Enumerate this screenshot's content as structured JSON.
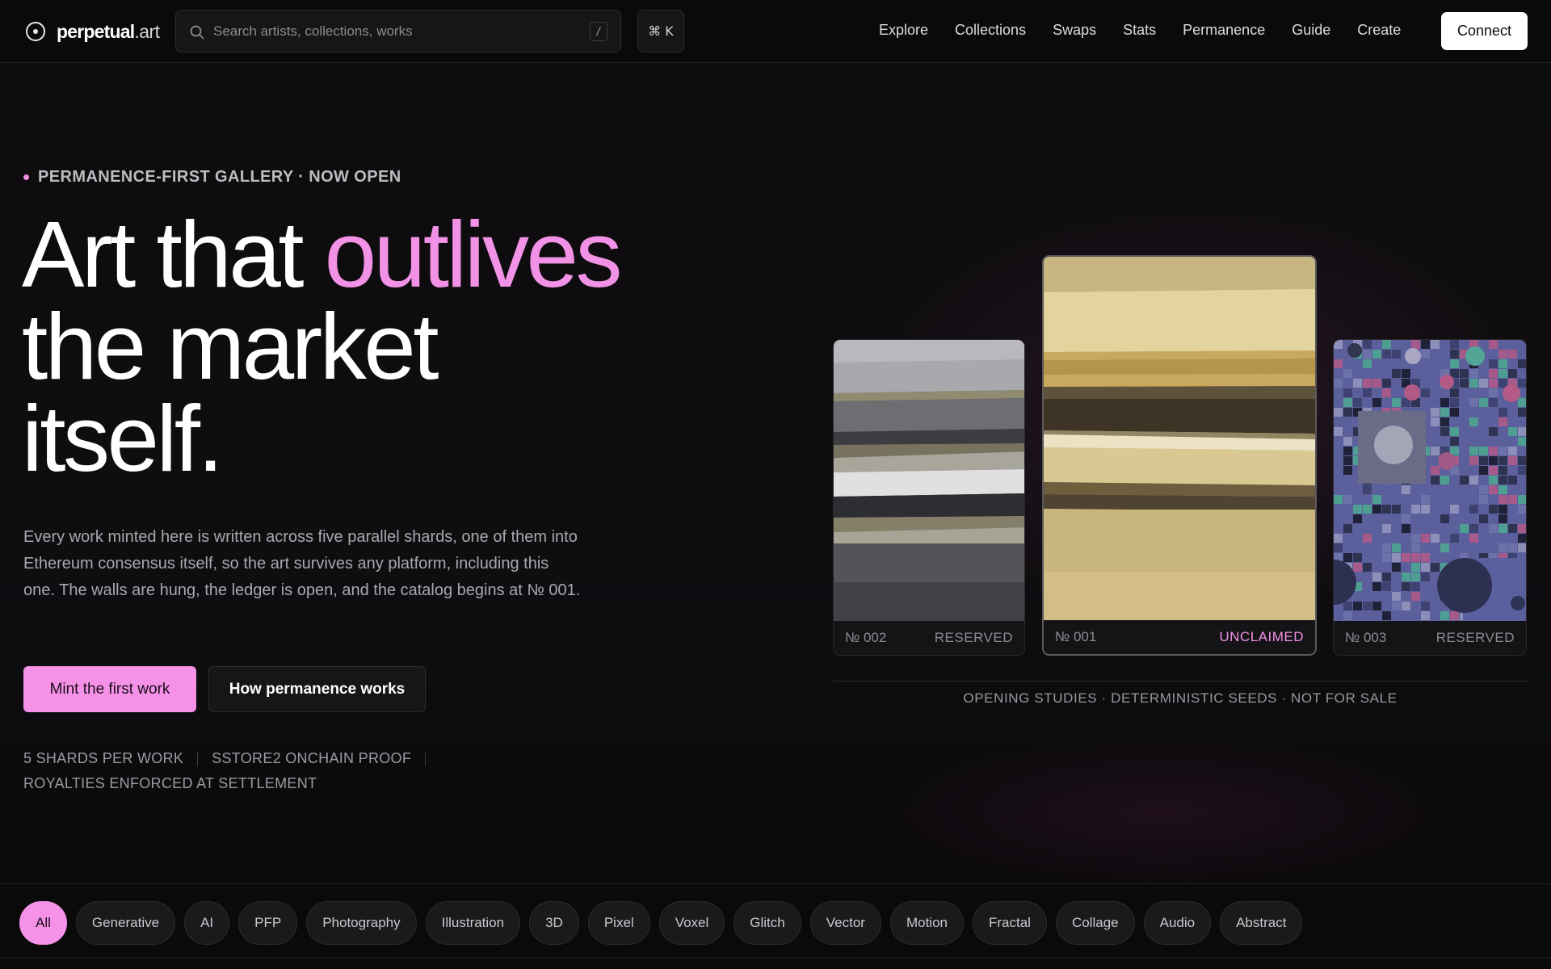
{
  "brand": {
    "name": "perpetual",
    "tld": ".art"
  },
  "search": {
    "placeholder": "Search artists, collections, works",
    "shortcut": "/"
  },
  "command_key": "⌘ K",
  "nav": {
    "links": [
      "Explore",
      "Collections",
      "Swaps",
      "Stats",
      "Permanence",
      "Guide",
      "Create"
    ],
    "connect_label": "Connect"
  },
  "hero": {
    "eyebrow": "PERMANENCE-FIRST GALLERY · NOW OPEN",
    "headline_part1": "Art that ",
    "headline_accent": "outlives",
    "headline_line2": "the market",
    "headline_line3": "itself.",
    "lede": "Every work minted here is written across five parallel shards, one of them into Ethereum consensus itself, so the art survives any platform, including this one. The walls are hung, the ledger is open, and the catalog begins at № 001.",
    "primary_cta": "Mint the first work",
    "secondary_cta": "How permanence works",
    "facts": [
      "5 SHARDS PER WORK",
      "SSTORE2 ONCHAIN PROOF",
      "ROYALTIES ENFORCED AT SETTLEMENT"
    ]
  },
  "gallery": {
    "cards": [
      {
        "number": "№ 002",
        "status": "RESERVED"
      },
      {
        "number": "№ 001",
        "status": "UNCLAIMED"
      },
      {
        "number": "№ 003",
        "status": "RESERVED"
      }
    ],
    "caption": "OPENING STUDIES · DETERMINISTIC SEEDS · NOT FOR SALE"
  },
  "categories": {
    "active": "All",
    "items": [
      "All",
      "Generative",
      "AI",
      "PFP",
      "Photography",
      "Illustration",
      "3D",
      "Pixel",
      "Voxel",
      "Glitch",
      "Vector",
      "Motion",
      "Fractal",
      "Collage",
      "Audio",
      "Abstract"
    ]
  },
  "colors": {
    "accent": "#f292e6",
    "background": "#0b0a0c",
    "surface": "#161517"
  }
}
